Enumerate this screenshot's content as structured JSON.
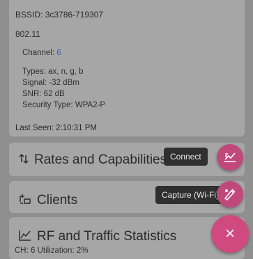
{
  "details": {
    "bssid": "BSSID: 3c3786-719307",
    "standard": "802.11",
    "channel_label": "Channel:",
    "channel_value": "6",
    "types": "Types: ax, n, g, b",
    "signal": "Signal: -32 dBm",
    "snr": "SNR: 62 dB",
    "security": "Security Type: WPA2-P",
    "last_seen": "Last Seen: 2:10:31 PM"
  },
  "sections": {
    "rates": "Rates and Capabilities",
    "clients": "Clients",
    "rf": "RF and Traffic Statistics",
    "rf_sub": "CH: 6   Utilization: 2%"
  },
  "speed_dial": {
    "connect_label": "Connect",
    "capture_label": "Capture (Wi-Fi)",
    "close_symbol": "×"
  },
  "icons": {
    "rates": "arrows-updown-icon",
    "clients": "clients-icon",
    "rf": "chart-line-icon",
    "connect": "connect-icon",
    "capture": "capture-icon",
    "close": "close-icon"
  },
  "colors": {
    "accent": "#c0487b",
    "link_blue": "#2a62c9",
    "tooltip_bg": "#2f2f2f"
  }
}
